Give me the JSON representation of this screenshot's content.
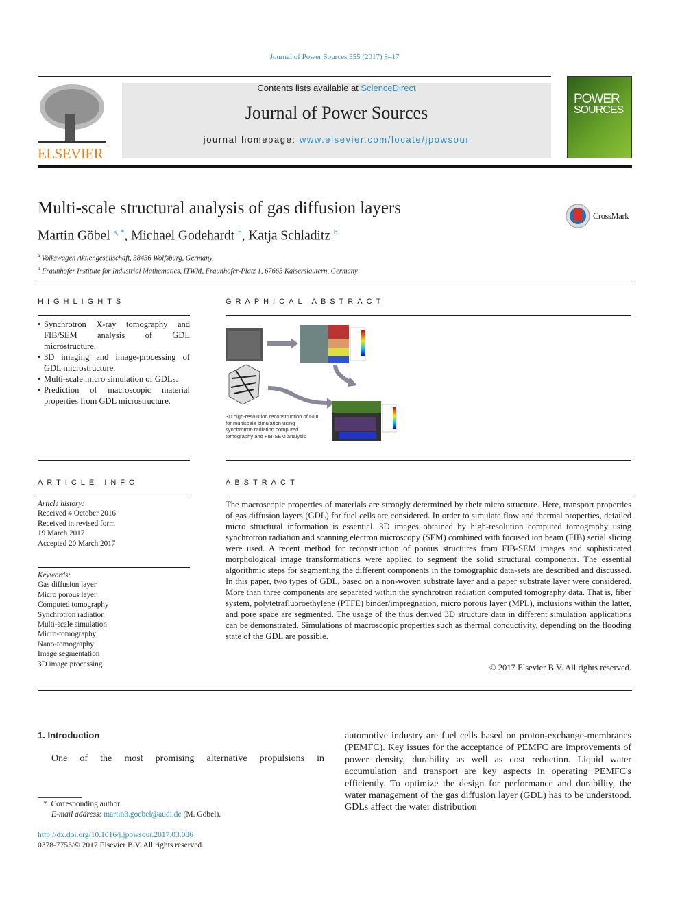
{
  "header": {
    "citation": "Journal of Power Sources 355 (2017) 8–17",
    "contents_prefix": "Contents lists available at ",
    "contents_link": "ScienceDirect",
    "journal_title": "Journal of Power Sources",
    "homepage_prefix": "journal homepage: ",
    "homepage_link": "www.elsevier.com/locate/jpowsour",
    "publisher_logo": "ELSEVIER",
    "cover_title_1": "POWER",
    "cover_title_2": "SOURCES"
  },
  "article": {
    "title": "Multi-scale structural analysis of gas diffusion layers",
    "crossmark": "CrossMark",
    "authors": [
      {
        "name": "Martin Göbel",
        "sup": "a, *"
      },
      {
        "name": "Michael Godehardt",
        "sup": "b"
      },
      {
        "name": "Katja Schladitz",
        "sup": "b"
      }
    ],
    "affiliations": [
      {
        "sup": "a",
        "text": "Volkswagen Aktiengesellschaft, 38436 Wolfsburg, Germany"
      },
      {
        "sup": "b",
        "text": "Fraunhofer Institute for Industrial Mathematics, ITWM, Fraunhofer-Platz 1, 67663 Kaiserslautern, Germany"
      }
    ]
  },
  "highlights": {
    "heading": "HIGHLIGHTS",
    "items": [
      "Synchrotron X-ray tomography and FIB/SEM analysis of GDL microstructure.",
      "3D imaging and image-processing of GDL microstructure.",
      "Multi-scale micro simulation of GDLs.",
      "Prediction of macroscopic material properties from GDL microstructure."
    ]
  },
  "graphical_abstract": {
    "heading": "GRAPHICAL ABSTRACT",
    "caption": "3D high-resolution reconstruction of GDL for multiscale simulation using synchrotron radiation computed tomography and FIB-SEM analysis"
  },
  "article_info": {
    "heading": "ARTICLE INFO",
    "history_label": "Article history:",
    "history": [
      "Received 4 October 2016",
      "Received in revised form",
      "19 March 2017",
      "Accepted 20 March 2017"
    ],
    "keywords_label": "Keywords:",
    "keywords": [
      "Gas diffusion layer",
      "Micro porous layer",
      "Computed tomography",
      "Synchrotron radiation",
      "Multi-scale simulation",
      "Micro-tomography",
      "Nano-tomography",
      "Image segmentation",
      "3D image processing"
    ]
  },
  "abstract": {
    "heading": "ABSTRACT",
    "text": "The macroscopic properties of materials are strongly determined by their micro structure. Here, transport properties of gas diffusion layers (GDL) for fuel cells are considered. In order to simulate flow and thermal properties, detailed micro structural information is essential. 3D images obtained by high-resolution computed tomography using synchrotron radiation and scanning electron microscopy (SEM) combined with focused ion beam (FIB) serial slicing were used. A recent method for reconstruction of porous structures from FIB-SEM images and sophisticated morphological image transformations were applied to segment the solid structural components. The essential algorithmic steps for segmenting the different components in the tomographic data-sets are described and discussed. In this paper, two types of GDL, based on a non-woven substrate layer and a paper substrate layer were considered. More than three components are separated within the synchrotron radiation computed tomography data. That is, fiber system, polytetrafluoroethylene (PTFE) binder/impregnation, micro porous layer (MPL), inclusions within the latter, and pore space are segmented. The usage of the thus derived 3D structure data in different simulation applications can be demonstrated. Simulations of macroscopic properties such as thermal conductivity, depending on the flooding state of the GDL are possible.",
    "copyright": "© 2017 Elsevier B.V. All rights reserved."
  },
  "body": {
    "section_heading": "1.  Introduction",
    "left_text": "One of the most promising alternative propulsions in",
    "right_text": "automotive industry are fuel cells based on proton-exchange-membranes (PEMFC). Key issues for the acceptance of PEMFC are improvements of power density, durability as well as cost reduction. Liquid water accumulation and transport are key aspects in operating PEMFC's efficiently. To optimize the design for performance and durability, the water management of the gas diffusion layer (GDL) has to be understood. GDLs affect the water distribution"
  },
  "footnote": {
    "marker": "*",
    "corresponding": "Corresponding author.",
    "email_label": "E-mail address:",
    "email": "martin3.goebel@audi.de",
    "email_suffix": " (M. Göbel).",
    "doi": "http://dx.doi.org/10.1016/j.jpowsour.2017.03.086",
    "issn": "0378-7753/© 2017 Elsevier B.V. All rights reserved."
  }
}
